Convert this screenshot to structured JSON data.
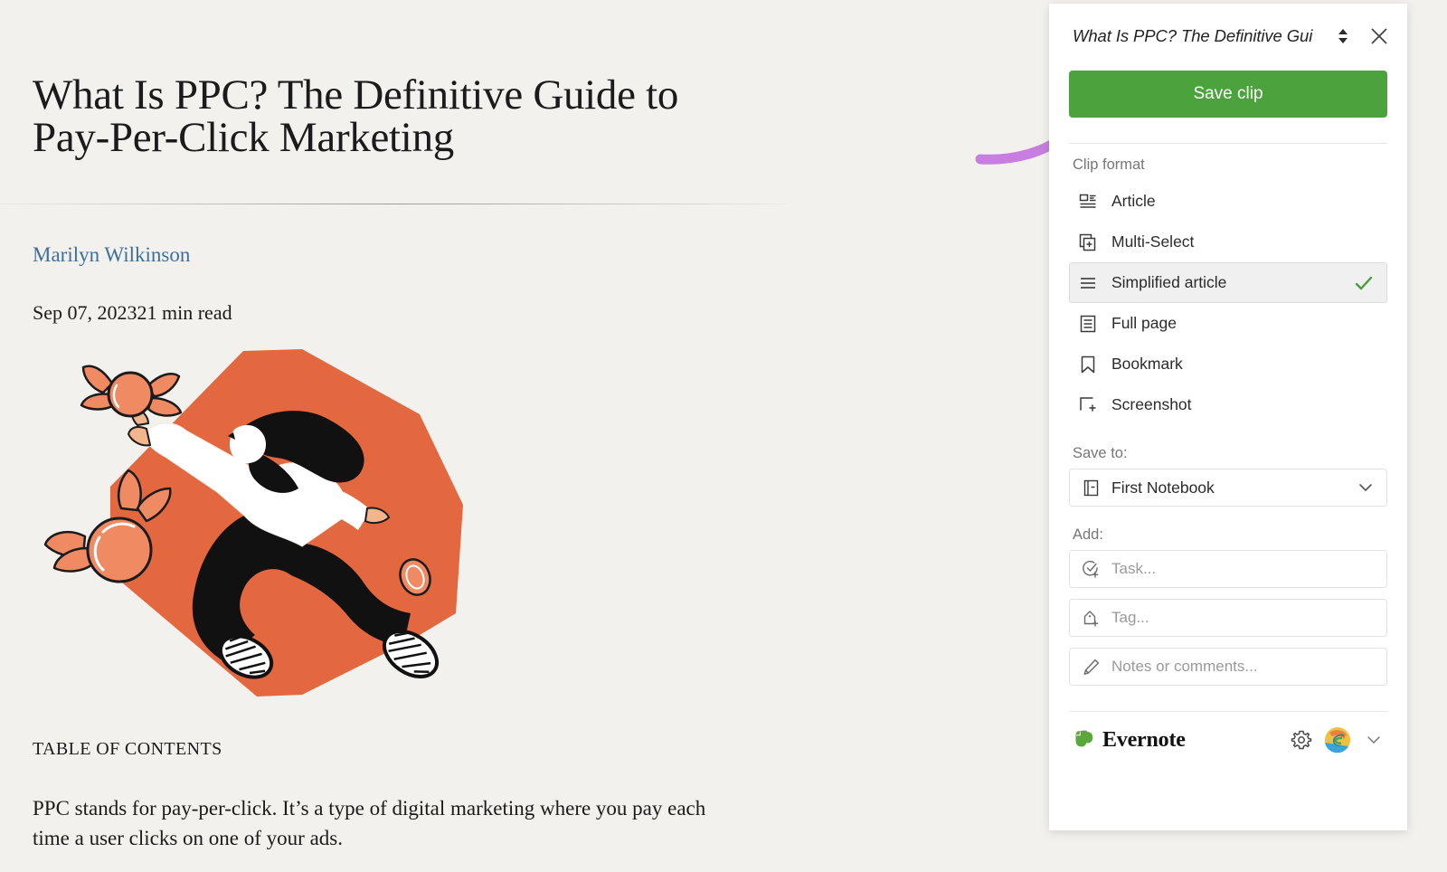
{
  "article": {
    "title": "What Is PPC? The Definitive Guide to Pay-Per-Click Marketing",
    "author": "Marilyn Wilkinson",
    "meta": "Sep 07, 202321 min read",
    "toc_heading": "TABLE OF CONTENTS",
    "paragraph": "PPC stands for pay-per-click. It’s a type of digital marketing where you pay each time a user clicks on one of your ads.",
    "hero_illustration_alt": "person-flying-with-winged-coins-illustration",
    "background_color": "#f2f1ed",
    "link_color": "#3d6f9e",
    "illustration_orange": "#e3683f"
  },
  "annotation": {
    "arrow_color": "#c77ee0",
    "points_to": "save-clip-button"
  },
  "clipper": {
    "header": {
      "clip_title": "What Is PPC? The Definitive Gui",
      "expand_icon": "expand-collapse-icon",
      "close_icon": "close-icon"
    },
    "save_button": {
      "label": "Save clip",
      "color": "#4ca33d"
    },
    "clip_format": {
      "label": "Clip format",
      "selected": "Simplified article",
      "check_color": "#4a9a3a",
      "options": [
        {
          "label": "Article",
          "icon": "article-icon",
          "selected": false
        },
        {
          "label": "Multi-Select",
          "icon": "multi-select-icon",
          "selected": false
        },
        {
          "label": "Simplified article",
          "icon": "simplified-article-icon",
          "selected": true
        },
        {
          "label": "Full page",
          "icon": "full-page-icon",
          "selected": false
        },
        {
          "label": "Bookmark",
          "icon": "bookmark-icon",
          "selected": false
        },
        {
          "label": "Screenshot",
          "icon": "screenshot-icon",
          "selected": false
        }
      ]
    },
    "save_to": {
      "label": "Save to:",
      "value": "First Notebook",
      "icon": "notebook-icon",
      "chevron": "chevron-down-icon"
    },
    "add": {
      "label": "Add:",
      "fields": [
        {
          "placeholder": "Task...",
          "icon": "task-circle-plus-icon"
        },
        {
          "placeholder": "Tag...",
          "icon": "tag-plus-icon"
        },
        {
          "placeholder": "Notes or comments...",
          "icon": "pencil-icon"
        }
      ]
    },
    "footer": {
      "brand": "Evernote",
      "brand_color": "#5aa83c",
      "settings_icon": "gear-icon",
      "account_icon": "account-avatar",
      "chevron": "chevron-down-icon"
    }
  }
}
